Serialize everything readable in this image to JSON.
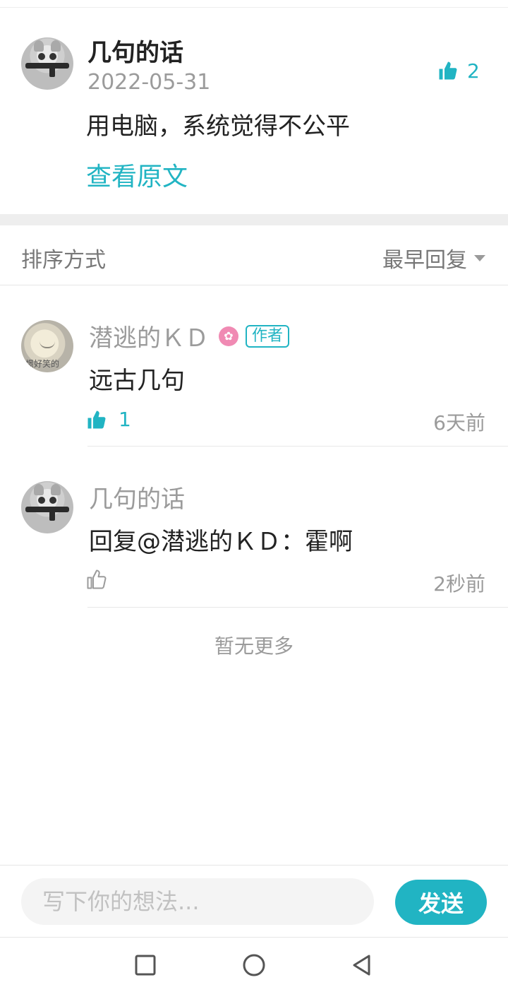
{
  "post": {
    "author": "几句的话",
    "date": "2022-05-31",
    "text": "用电脑，系统觉得不公平",
    "view_original": "查看原文",
    "like_count": "2"
  },
  "sort": {
    "label": "排序方式",
    "selected": "最早回复"
  },
  "comments": [
    {
      "author": "潜逃的ＫＤ",
      "author_tag": "作者",
      "avatar_caption": "憬好笑的",
      "text": "远古几句",
      "like_count": "1",
      "time": "6天前"
    },
    {
      "author": "几句的话",
      "text": "回复@潜逃的ＫＤ：霍啊",
      "like_count": "",
      "time": "2秒前"
    }
  ],
  "no_more": "暂无更多",
  "input": {
    "placeholder": "写下你的想法...",
    "send_label": "发送"
  },
  "colors": {
    "accent": "#21b4c3",
    "badge": "#f08ab3"
  },
  "icons": {
    "like": "thumbs-up-icon",
    "nav_recent": "square-icon",
    "nav_home": "circle-icon",
    "nav_back": "triangle-back-icon"
  }
}
